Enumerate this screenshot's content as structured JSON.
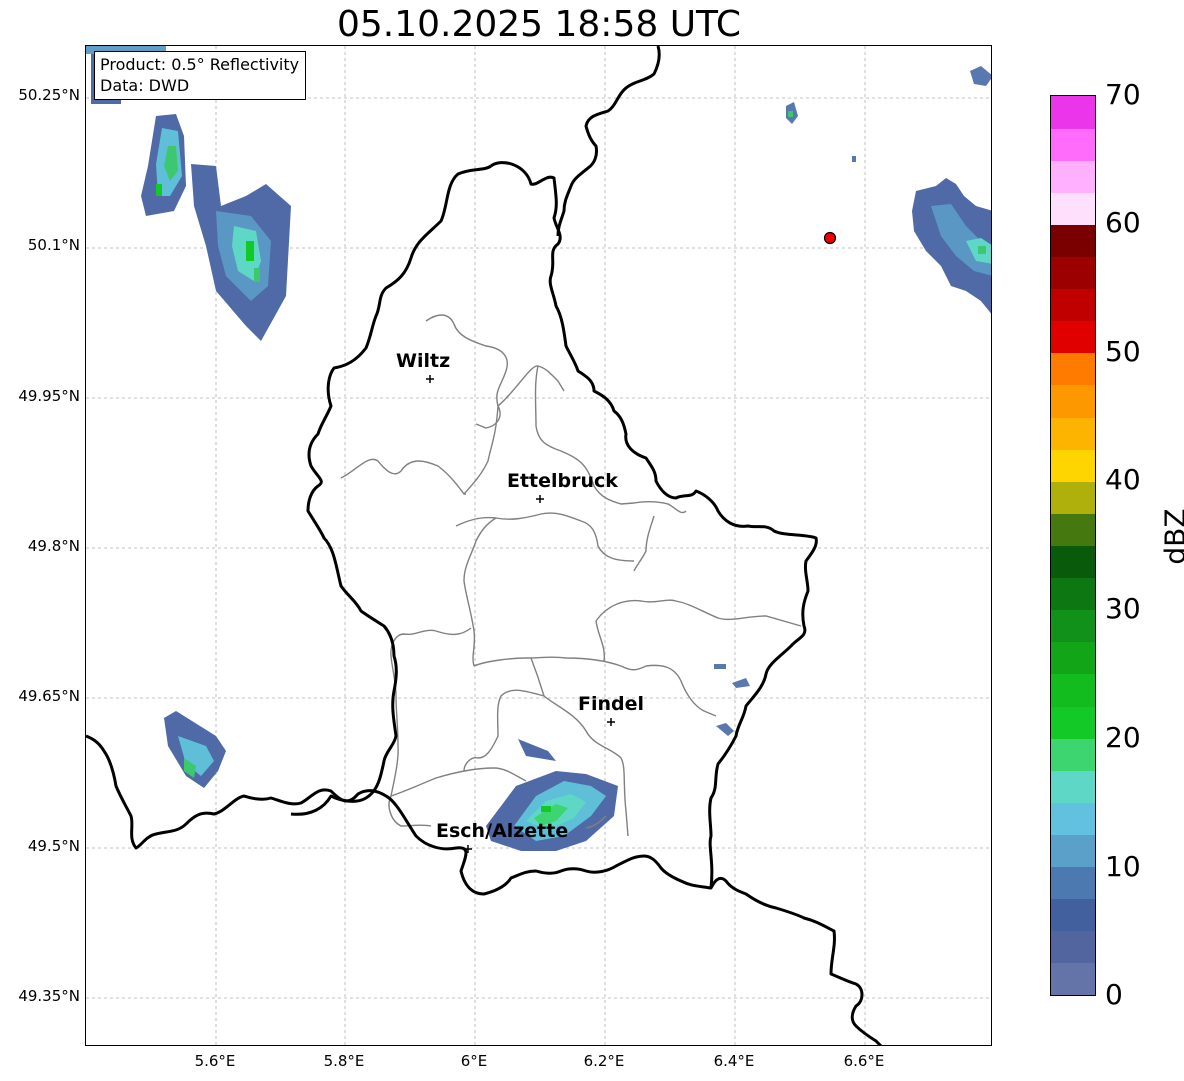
{
  "title": "05.10.2025 18:58 UTC",
  "info_box": {
    "product": "Product: 0.5° Reflectivity",
    "data": "Data: DWD"
  },
  "lat_labels": [
    "50.25°N",
    "50.1°N",
    "49.95°N",
    "49.8°N",
    "49.65°N",
    "49.5°N",
    "49.35°N"
  ],
  "lon_labels": [
    "5.6°E",
    "5.8°E",
    "6°E",
    "6.2°E",
    "6.4°E",
    "6.6°E"
  ],
  "cities": [
    {
      "name": "Wiltz"
    },
    {
      "name": "Ettelbruck"
    },
    {
      "name": "Findel"
    },
    {
      "name": "Esch/Alzette"
    }
  ],
  "colorbar": {
    "label": "dBZ",
    "ticks": [
      "0",
      "10",
      "20",
      "30",
      "40",
      "50",
      "60",
      "70"
    ],
    "colors": [
      "#6473a8",
      "#52659e",
      "#425f9e",
      "#4b79b0",
      "#5ba0c9",
      "#62c1de",
      "#5ed7c6",
      "#3dd570",
      "#12c928",
      "#12bb1e",
      "#12a518",
      "#12911a",
      "#0d7811",
      "#0a5a0c",
      "#467810",
      "#b0b00c",
      "#ffd500",
      "#fdb400",
      "#fe9800",
      "#ff7b00",
      "#e00000",
      "#c00000",
      "#9d0000",
      "#7a0000",
      "#fee0fd",
      "#ffb1ff",
      "#ff6cfc",
      "#ea35ea"
    ]
  },
  "marker_color": "#ee0000"
}
